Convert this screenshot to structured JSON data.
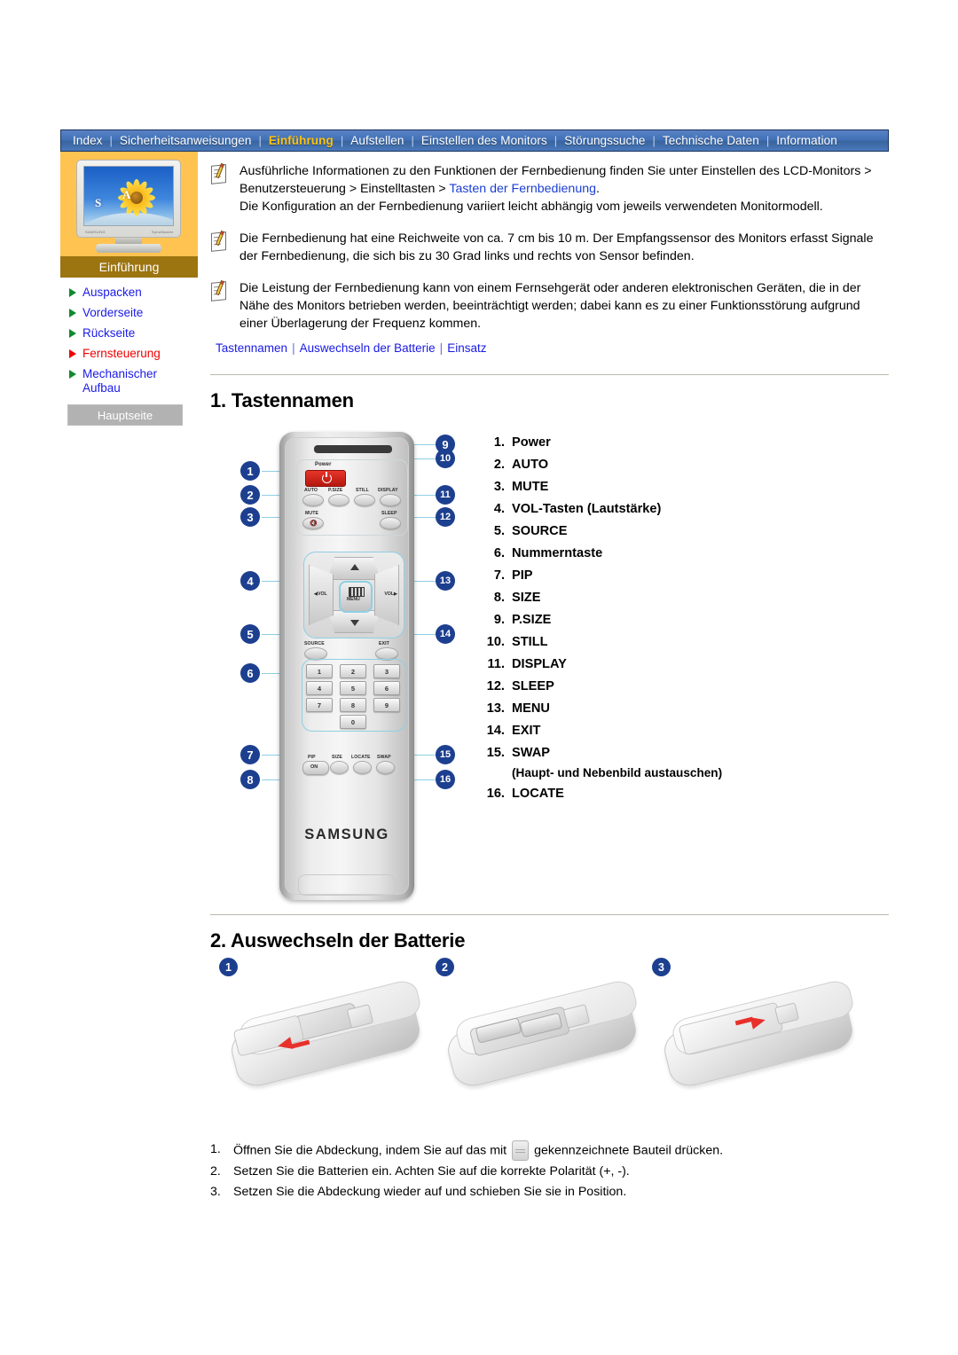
{
  "topnav": {
    "items": [
      {
        "label": "Index",
        "active": false
      },
      {
        "label": "Sicherheitsanweisungen",
        "active": false
      },
      {
        "label": "Einführung",
        "active": true
      },
      {
        "label": "Aufstellen",
        "active": false
      },
      {
        "label": "Einstellen des Monitors",
        "active": false
      },
      {
        "label": "Störungssuche",
        "active": false
      },
      {
        "label": "Technische Daten",
        "active": false
      },
      {
        "label": "Information",
        "active": false
      }
    ]
  },
  "sidebar": {
    "card_label": "Einführung",
    "monitor_letters": {
      "s": "S",
      "a": "A"
    },
    "monitor_brand_left": "SAMSUNG",
    "monitor_brand_right": "SyncMaster",
    "items": [
      {
        "label": "Auspacken",
        "active": false
      },
      {
        "label": "Vorderseite",
        "active": false
      },
      {
        "label": "Rückseite",
        "active": false
      },
      {
        "label": "Fernsteuerung",
        "active": true
      },
      {
        "label": "Mechanischer Aufbau",
        "active": false
      }
    ],
    "home_button": "Hauptseite"
  },
  "notes": [
    {
      "text_before": "Ausführliche Informationen zu den Funktionen der Fernbedienung finden Sie unter Einstellen des LCD-Monitors > Benutzersteuerung > Einstelltasten > ",
      "link": "Tasten der Fernbedienung",
      "text_after": ".",
      "text_line2": "Die Konfiguration an der Fernbedienung variiert leicht abhängig vom jeweils verwendeten Monitormodell."
    },
    {
      "text_before": "Die Fernbedienung hat eine Reichweite von ca. 7 cm bis 10 m. Der Empfangssensor des Monitors erfasst Signale der Fernbedienung, die sich bis zu 30 Grad links und rechts von Sensor befinden.",
      "link": "",
      "text_after": "",
      "text_line2": ""
    },
    {
      "text_before": "Die Leistung der Fernbedienung kann von einem Fernsehgerät oder anderen elektronischen Geräten, die in der Nähe des Monitors betrieben werden, beeinträchtigt werden; dabei kann es zu einer Funktionsstörung aufgrund einer Überlagerung der Frequenz kommen.",
      "link": "",
      "text_after": "",
      "text_line2": ""
    }
  ],
  "sublinks": [
    "Tastennamen",
    "Auswechseln der Batterie",
    "Einsatz"
  ],
  "section1": {
    "heading": "1. Tastennamen",
    "buttons": [
      {
        "num": "1.",
        "label": "Power"
      },
      {
        "num": "2.",
        "label": "AUTO"
      },
      {
        "num": "3.",
        "label": "MUTE"
      },
      {
        "num": "4.",
        "label": "VOL-Tasten (Lautstärke)"
      },
      {
        "num": "5.",
        "label": "SOURCE"
      },
      {
        "num": "6.",
        "label": "Nummerntaste"
      },
      {
        "num": "7.",
        "label": "PIP"
      },
      {
        "num": "8.",
        "label": "SIZE"
      },
      {
        "num": "9.",
        "label": "P.SIZE"
      },
      {
        "num": "10.",
        "label": "STILL"
      },
      {
        "num": "11.",
        "label": "DISPLAY"
      },
      {
        "num": "12.",
        "label": "SLEEP"
      },
      {
        "num": "13.",
        "label": "MENU"
      },
      {
        "num": "14.",
        "label": "EXIT"
      },
      {
        "num": "15.",
        "label": "SWAP",
        "sub": "(Haupt- und Nebenbild austauschen)"
      },
      {
        "num": "16.",
        "label": "LOCATE"
      }
    ],
    "callouts": [
      "1",
      "2",
      "3",
      "4",
      "5",
      "6",
      "7",
      "8",
      "9",
      "10",
      "11",
      "12",
      "13",
      "14",
      "15",
      "16"
    ],
    "remote": {
      "power_label": "Power",
      "auto_label": "AUTO",
      "psize_label": "P.SIZE",
      "still_label": "STILL",
      "display_label": "DISPLAY",
      "mute_label": "MUTE",
      "sleep_label": "SLEEP",
      "vol_left_label": "VOL",
      "vol_right_label": "VOL",
      "menu_label": "MENU",
      "source_label": "SOURCE",
      "exit_label": "EXIT",
      "keys": [
        "1",
        "2",
        "3",
        "4",
        "5",
        "6",
        "7",
        "8",
        "9",
        "0"
      ],
      "pip_label": "PIP",
      "pip_on_label": "ON",
      "size_label": "SIZE",
      "locate_label": "LOCATE",
      "swap_label": "SWAP",
      "brand": "SAMSUNG"
    }
  },
  "section2": {
    "heading": "2. Auswechseln der Batterie",
    "steps": [
      "1",
      "2",
      "3"
    ],
    "instructions": [
      {
        "num": "1.",
        "before": "Öffnen Sie die Abdeckung, indem Sie auf das mit",
        "after": "gekennzeichnete Bauteil drücken.",
        "has_icon": true
      },
      {
        "num": "2.",
        "before": "Setzen Sie die Batterien ein. Achten Sie auf die korrekte Polarität (+, -).",
        "after": "",
        "has_icon": false
      },
      {
        "num": "3.",
        "before": "Setzen Sie die Abdeckung wieder auf und schieben Sie sie in Position.",
        "after": "",
        "has_icon": false
      }
    ]
  },
  "colors": {
    "nav_blue": "#4272b8",
    "nav_active": "#ffc20e",
    "sidebar_orange": "#ffc352",
    "sidebar_label_brown": "#9c7410",
    "link_blue": "#1a1ae6",
    "active_red": "#f00000",
    "badge_navy": "#1d3f8f",
    "callout_line": "#8ecfe4"
  }
}
